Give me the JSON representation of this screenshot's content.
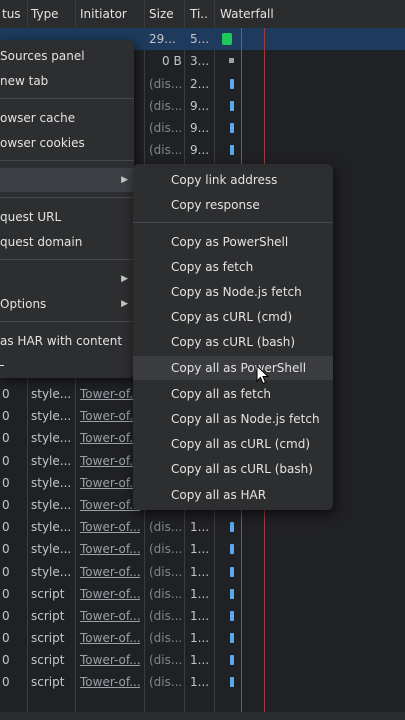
{
  "columns": [
    "tus",
    "Type",
    "Initiator",
    "Size",
    "Ti..",
    "Waterfall"
  ],
  "top_rows": [
    {
      "size": "29...",
      "time": "5..."
    },
    {
      "size": "0 B",
      "time": "3..."
    },
    {
      "size": "(dis...",
      "time": "2..."
    },
    {
      "size": "(dis...",
      "time": "9..."
    },
    {
      "size": "(dis...",
      "time": "9..."
    },
    {
      "size": "(dis...",
      "time": "9..."
    }
  ],
  "rows": [
    {
      "status": "0",
      "type": "style...",
      "initiator": "Tower-of...",
      "size": "",
      "time": ""
    },
    {
      "status": "0",
      "type": "style...",
      "initiator": "Tower-of...",
      "size": "",
      "time": ""
    },
    {
      "status": "0",
      "type": "style...",
      "initiator": "Tower-of...",
      "size": "",
      "time": ""
    },
    {
      "status": "0",
      "type": "style...",
      "initiator": "Tower-of...",
      "size": "",
      "time": ""
    },
    {
      "status": "0",
      "type": "style...",
      "initiator": "Tower-of...",
      "size": "",
      "time": ""
    },
    {
      "status": "0",
      "type": "style...",
      "initiator": "Tower-of...",
      "size": "",
      "time": ""
    },
    {
      "status": "0",
      "type": "style...",
      "initiator": "Tower-of...",
      "size": "(dis...",
      "time": "1..."
    },
    {
      "status": "0",
      "type": "style...",
      "initiator": "Tower-of...",
      "size": "(dis...",
      "time": "1..."
    },
    {
      "status": "0",
      "type": "style...",
      "initiator": "Tower-of...",
      "size": "(dis...",
      "time": "1..."
    },
    {
      "status": "0",
      "type": "script",
      "initiator": "Tower-of...",
      "size": "(dis...",
      "time": "1..."
    },
    {
      "status": "0",
      "type": "script",
      "initiator": "Tower-of...",
      "size": "(dis...",
      "time": "1..."
    },
    {
      "status": "0",
      "type": "script",
      "initiator": "Tower-of...",
      "size": "(dis...",
      "time": "1..."
    },
    {
      "status": "0",
      "type": "script",
      "initiator": "Tower-of...",
      "size": "(dis...",
      "time": "1..."
    },
    {
      "status": "0",
      "type": "script",
      "initiator": "Tower-of...",
      "size": "(dis...",
      "time": "1..."
    }
  ],
  "context_menu": {
    "items": [
      "Sources panel",
      "new tab",
      "owser cache",
      "owser cookies",
      "",
      "quest URL",
      "quest domain",
      "",
      "Options",
      "as HAR with content"
    ]
  },
  "submenu": {
    "group1": [
      "Copy link address",
      "Copy response"
    ],
    "group2": [
      "Copy as PowerShell",
      "Copy as fetch",
      "Copy as Node.js fetch",
      "Copy as cURL (cmd)",
      "Copy as cURL (bash)",
      "Copy all as PowerShell",
      "Copy all as fetch",
      "Copy all as Node.js fetch",
      "Copy all as cURL (cmd)",
      "Copy all as cURL (bash)",
      "Copy all as HAR"
    ]
  }
}
